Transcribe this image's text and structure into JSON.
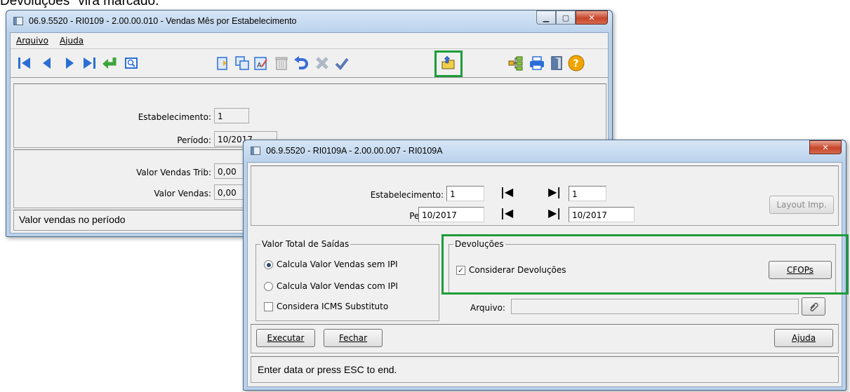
{
  "caption": "Devoluções\" vira marcado.",
  "main_window": {
    "title": "06.9.5520 - RI0109 - 2.00.00.010 - Vendas Mês por Estabelecimento",
    "menu": [
      "Arquivo",
      "Ajuda"
    ],
    "fields": {
      "estabelecimento_label": "Estabelecimento:",
      "estabelecimento_value": "1",
      "periodo_label": "Período:",
      "periodo_value": "10/2017",
      "valor_vendas_trib_label": "Valor Vendas Trib:",
      "valor_vendas_trib_value": "0,00",
      "valor_vendas_label": "Valor Vendas:",
      "valor_vendas_value": "0,00"
    },
    "status": "Valor vendas no período",
    "toolbar_icons": [
      "first-icon",
      "prev-icon",
      "next-icon",
      "last-icon",
      "goto-icon",
      "zoom-icon",
      "new-icon",
      "copy-icon",
      "edit-icon",
      "delete-icon",
      "undo-icon",
      "cancel-icon",
      "confirm-icon",
      "import-icon",
      "tree-icon",
      "print-icon",
      "exit-icon",
      "help-icon"
    ]
  },
  "dialog": {
    "title": "06.9.5520 - RI0109A - 2.00.00.007 - RI0109A",
    "estabelecimento_label": "Estabelecimento:",
    "estabelecimento_from": "1",
    "estabelecimento_to": "1",
    "periodo_label": "Período:",
    "periodo_from": "10/2017",
    "periodo_to": "10/2017",
    "layout_button": "Layout Imp.",
    "valor_total": {
      "title": "Valor Total de Saídas",
      "option1": "Calcula Valor Vendas sem IPI",
      "option2": "Calcula Valor Vendas com IPI",
      "checkbox": "Considera ICMS Substituto",
      "selected": "option1",
      "checkbox_checked": false
    },
    "devolucoes": {
      "title": "Devoluções",
      "checkbox": "Considerar Devoluções",
      "checked": true,
      "cfops_button": "CFOPs"
    },
    "arquivo_label": "Arquivo:",
    "arquivo_value": "",
    "executar": "Executar",
    "fechar": "Fechar",
    "ajuda": "Ajuda",
    "status": "Enter data or press ESC to end."
  },
  "colors": {
    "highlight": "#1e9c3a",
    "title_gradient_top": "#d7e6f6",
    "close_button": "#c7452a"
  }
}
